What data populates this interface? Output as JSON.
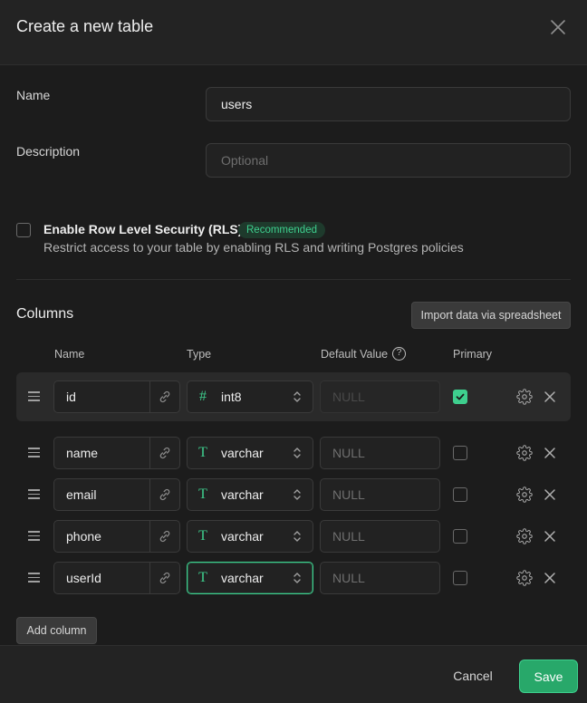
{
  "header": {
    "title": "Create a new table",
    "close_icon": "close-icon"
  },
  "form": {
    "name_label": "Name",
    "name_value": "users",
    "description_label": "Description",
    "description_placeholder": "Optional"
  },
  "rls": {
    "checked": false,
    "title": "Enable Row Level Security (RLS)",
    "badge": "Recommended",
    "description": "Restrict access to your table by enabling RLS and writing Postgres policies"
  },
  "columns": {
    "title": "Columns",
    "import_button": "Import data via spreadsheet",
    "headers": {
      "name": "Name",
      "type": "Type",
      "default_value": "Default Value",
      "primary": "Primary"
    },
    "help_icon": "question-circle-icon",
    "add_column_button": "Add column",
    "rows": [
      {
        "name": "id",
        "type": "int8",
        "type_icon": "hash-icon",
        "type_glyph": "#",
        "default_placeholder": "NULL",
        "primary": true
      },
      {
        "name": "name",
        "type": "varchar",
        "type_icon": "text-type-icon",
        "type_glyph": "T",
        "default_placeholder": "NULL",
        "primary": false
      },
      {
        "name": "email",
        "type": "varchar",
        "type_icon": "text-type-icon",
        "type_glyph": "T",
        "default_placeholder": "NULL",
        "primary": false
      },
      {
        "name": "phone",
        "type": "varchar",
        "type_icon": "text-type-icon",
        "type_glyph": "T",
        "default_placeholder": "NULL",
        "primary": false
      },
      {
        "name": "userId",
        "type": "varchar",
        "type_icon": "text-type-icon",
        "type_glyph": "T",
        "default_placeholder": "NULL",
        "primary": false
      }
    ]
  },
  "footer": {
    "cancel_button": "Cancel",
    "save_button": "Save"
  },
  "colors": {
    "accent": "#3ecf8e",
    "background": "#1c1c1c",
    "panel": "#232323"
  }
}
